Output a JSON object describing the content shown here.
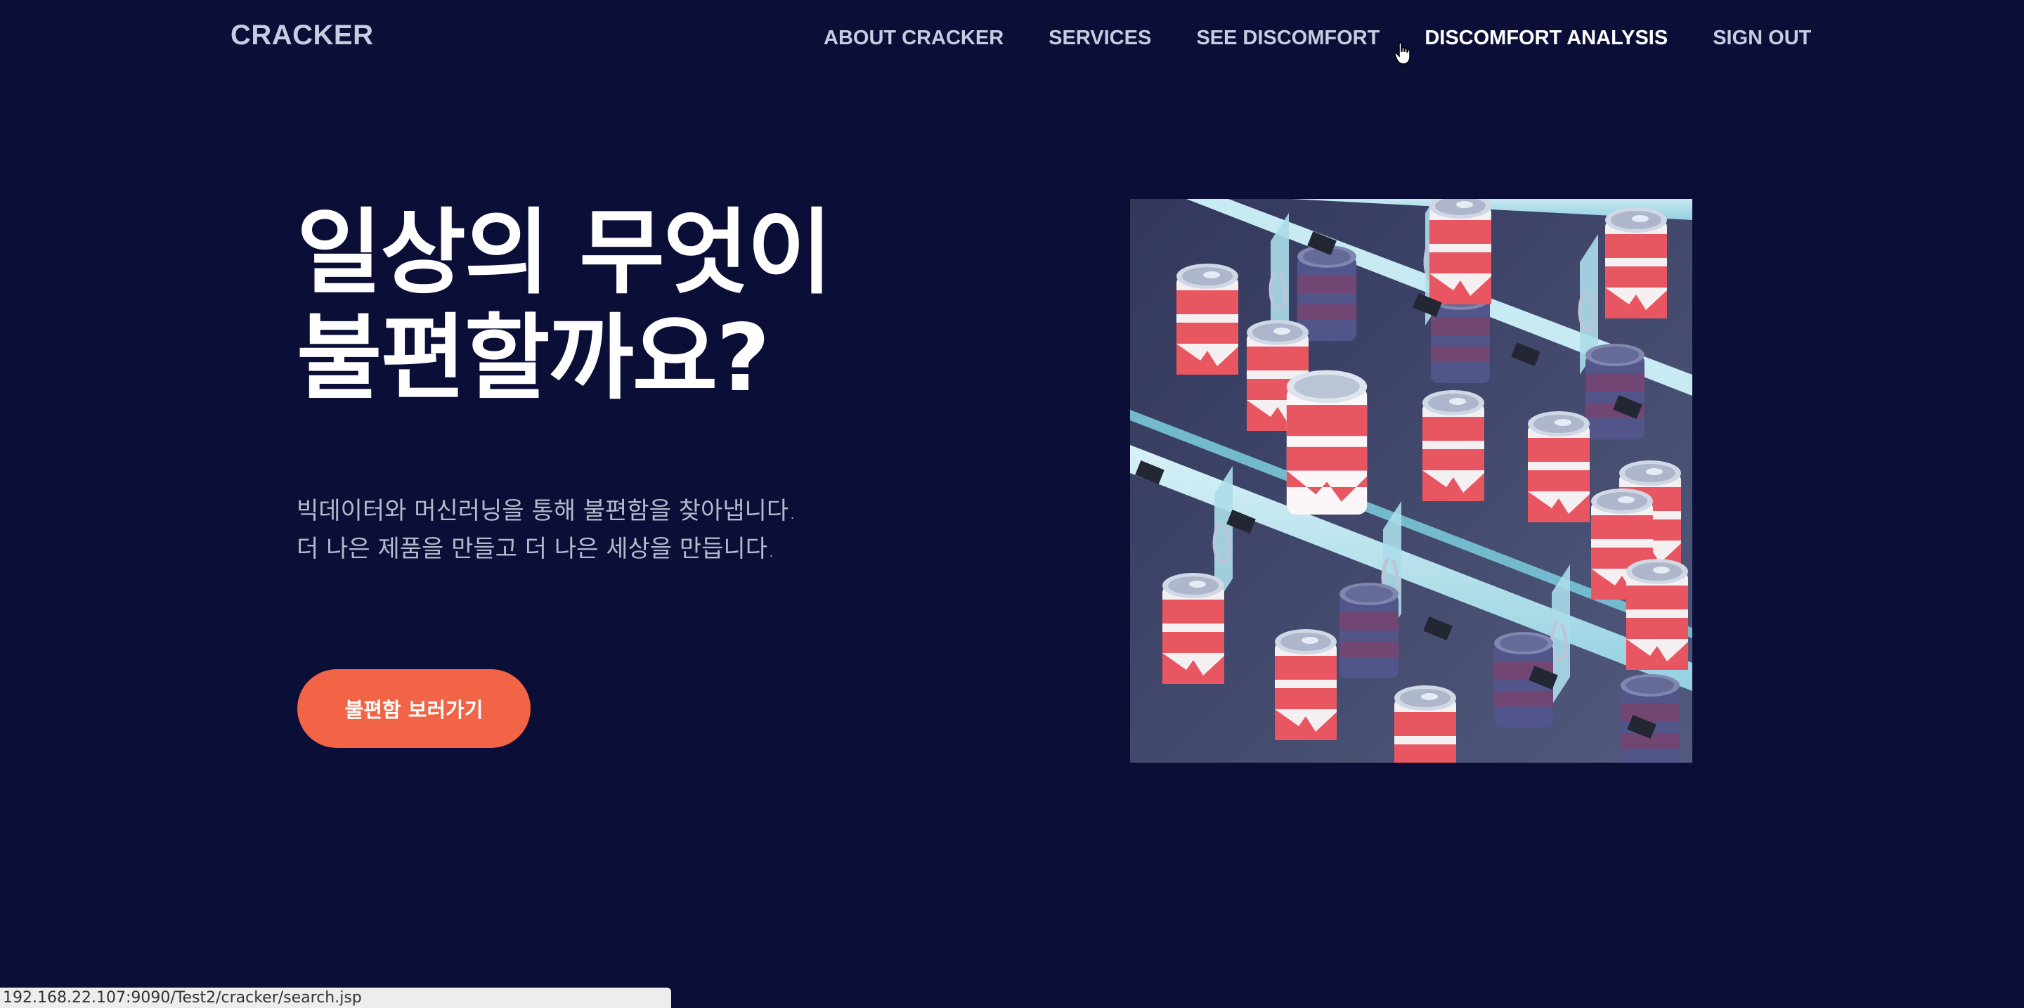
{
  "nav": {
    "brand": "CRACKER",
    "links": [
      {
        "label": "ABOUT CRACKER"
      },
      {
        "label": "SERVICES"
      },
      {
        "label": "SEE DISCOMFORT"
      },
      {
        "label": "DISCOMFORT ANALYSIS",
        "hovered": true
      },
      {
        "label": "SIGN OUT"
      }
    ]
  },
  "hero": {
    "title_line1": "일상의 무엇이",
    "title_line2": "불편할까요?",
    "subtitle_line1": "빅데이터와 머신러닝을 통해 불편함을 찾아냅니다.",
    "subtitle_line2": "더 나은 제품을 만들고 더 나은 세상을 만듭니다.",
    "cta_label": "불편함 보러가기",
    "image_icon": "vending-machine-cans-illustration"
  },
  "status_bar": {
    "url": "192.168.22.107:9090/Test2/cracker/search.jsp"
  },
  "colors": {
    "background": "#0b0f38",
    "nav_text": "#c9cbe0",
    "accent": "#f26446",
    "subtitle_text": "#b6b8cb",
    "can_red": "#e8505b",
    "machine_blue": "#9fd8e6"
  }
}
